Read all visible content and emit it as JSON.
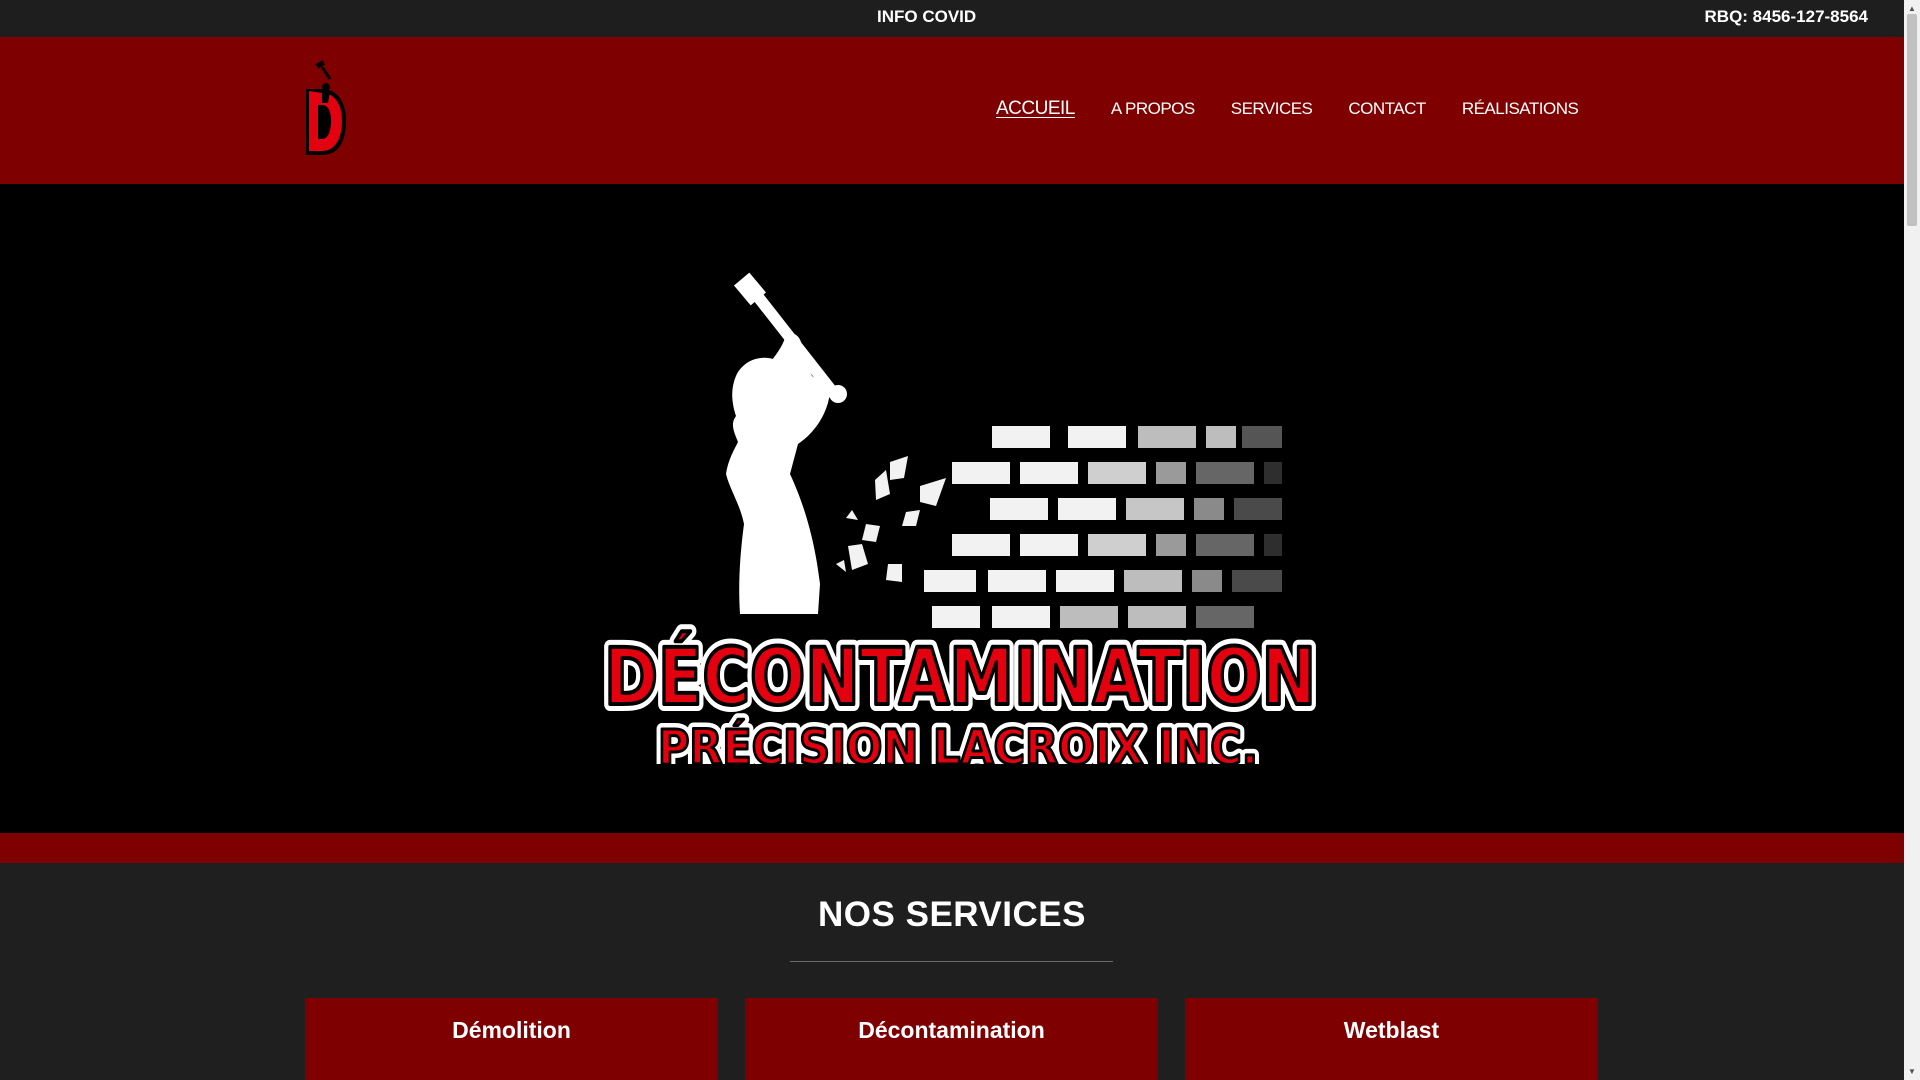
{
  "topbar": {
    "covid_link": "INFO COVID",
    "rbq": "RBQ: 8456-127-8564"
  },
  "header": {
    "logo_icon": "d-hammer-logo-icon",
    "nav": [
      {
        "label": "ACCUEIL",
        "active": true
      },
      {
        "label": "A PROPOS",
        "active": false
      },
      {
        "label": "SERVICES",
        "active": false
      },
      {
        "label": "CONTACT",
        "active": false
      },
      {
        "label": "RÉALISATIONS",
        "active": false
      }
    ]
  },
  "hero": {
    "logo_line1": "DÉCONTAMINATION",
    "logo_line2": "PRÉCISION LACROIX INC."
  },
  "services": {
    "title": "NOS SERVICES",
    "cards": [
      {
        "label": "Démolition"
      },
      {
        "label": "Décontamination"
      },
      {
        "label": "Wetblast"
      }
    ]
  },
  "colors": {
    "brand_red": "#7f0000",
    "logo_red": "#e3000f",
    "dark_bg": "#1f1f1f",
    "hero_bg": "#000000"
  }
}
